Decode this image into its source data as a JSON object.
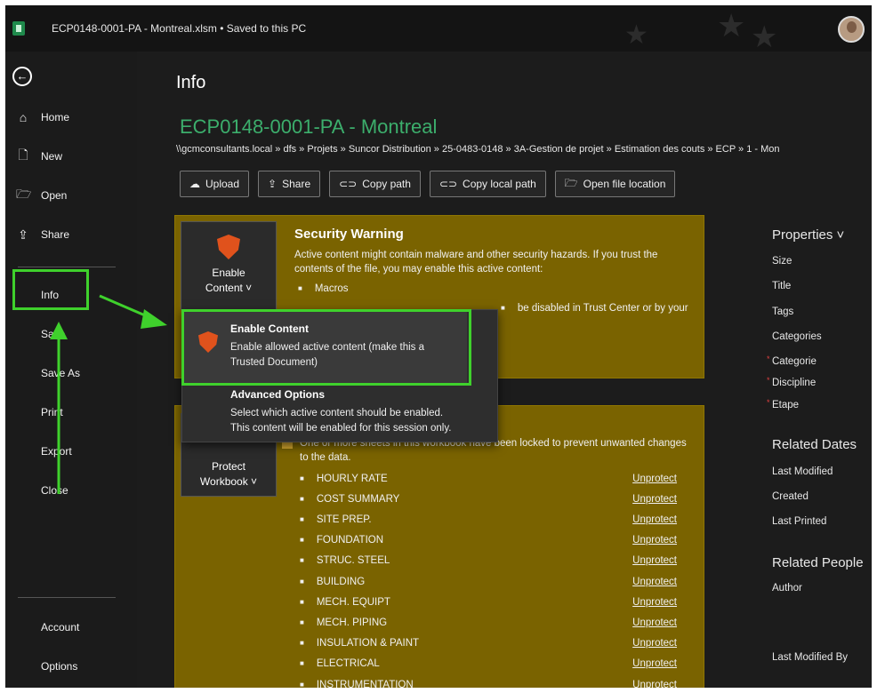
{
  "window": {
    "title": "ECP0148-0001-PA - Montreal.xlsm • Saved to this PC"
  },
  "sidebar": {
    "top_items": [
      {
        "label": "Home",
        "icon": "home-icon"
      },
      {
        "label": "New",
        "icon": "new-document-icon"
      },
      {
        "label": "Open",
        "icon": "folder-open-icon"
      },
      {
        "label": "Share",
        "icon": "share-icon"
      }
    ],
    "info": "Info",
    "mid_items": [
      "Save",
      "Save As",
      "Print",
      "Export",
      "Close"
    ],
    "bottom_items": [
      "Account",
      "Options"
    ]
  },
  "main": {
    "page_title": "Info",
    "file_title": "ECP0148-0001-PA - Montreal",
    "path": "\\\\gcmconsultants.local » dfs » Projets » Suncor Distribution » 25-0483-0148 » 3A-Gestion de projet » Estimation des couts » ECP » 1 - Mon",
    "buttons": [
      "Upload",
      "Share",
      "Copy path",
      "Copy local path",
      "Open file location"
    ]
  },
  "security": {
    "button_line1": "Enable",
    "button_line2": "Content ˅",
    "heading": "Security Warning",
    "text": "Active content might contain malware and other security hazards. If you trust the contents of the file, you may enable this active content:",
    "bullet": "Macros",
    "hidden_tail": "be disabled in Trust Center or by your"
  },
  "dropdown": {
    "item1_title": "Enable Content",
    "item1_desc_l1": "Enable allowed active content (make this a",
    "item1_desc_l2": "Trusted Document)",
    "item2_title": "Advanced Options",
    "item2_desc_l1": "Select which active content should be enabled.",
    "item2_desc_l2": "This content will be enabled for this session only."
  },
  "protect": {
    "button_line1": "Protect",
    "button_line2": "Workbook ˅",
    "lock_text": "One or more sheets in this workbook have been locked to prevent unwanted changes to the data.",
    "unprotect_label": "Unprotect",
    "sheets": [
      "HOURLY RATE",
      "COST SUMMARY",
      "SITE PREP.",
      "FOUNDATION",
      "STRUC. STEEL",
      "BUILDING",
      "MECH. EQUIPT",
      "MECH. PIPING",
      "INSULATION & PAINT",
      "ELECTRICAL",
      "INSTRUMENTATION"
    ]
  },
  "properties": {
    "heading": "Properties ˅",
    "fields": [
      "Size",
      "Title",
      "Tags",
      "Categories",
      "Categorie",
      "Discipline",
      "Etape"
    ],
    "dates_heading": "Related Dates",
    "dates": [
      "Last Modified",
      "Created",
      "Last Printed"
    ],
    "people_heading": "Related People",
    "author": "Author",
    "last_modified_by": "Last Modified By"
  },
  "colors": {
    "accent_green": "#3cae6c",
    "annotation_green": "#3fd12c",
    "warning_panel": "#7a6300",
    "shield": "#e0521c"
  }
}
